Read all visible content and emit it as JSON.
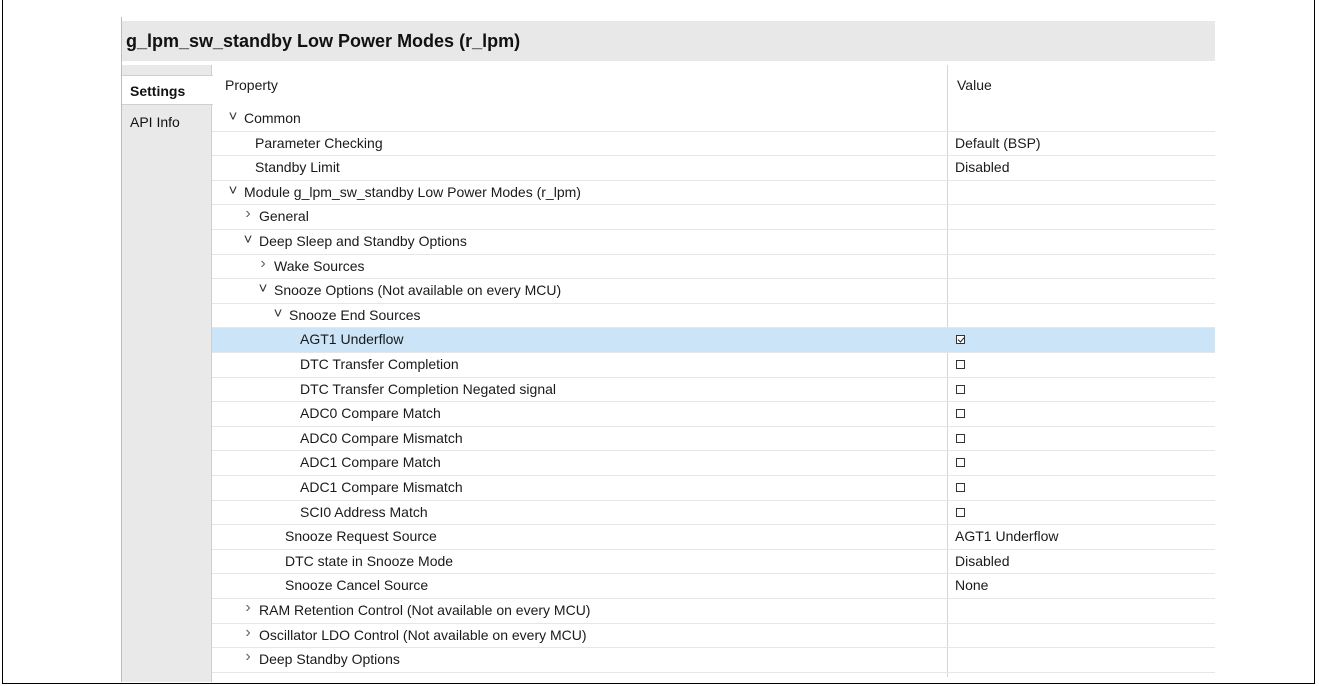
{
  "panel": {
    "title": "g_lpm_sw_standby Low Power Modes (r_lpm)",
    "tabs": [
      {
        "label": "Settings",
        "active": true
      },
      {
        "label": "API Info",
        "active": false
      }
    ]
  },
  "table": {
    "columns": {
      "property": "Property",
      "value": "Value"
    },
    "rows": [
      {
        "label": "Common",
        "level": 0,
        "toggle": "expanded",
        "value": ""
      },
      {
        "label": "Parameter Checking",
        "level": 1,
        "toggle": "none",
        "value": "Default (BSP)"
      },
      {
        "label": "Standby Limit",
        "level": 1,
        "toggle": "none",
        "value": "Disabled"
      },
      {
        "label": "Module g_lpm_sw_standby Low Power Modes (r_lpm)",
        "level": 0,
        "toggle": "expanded",
        "value": ""
      },
      {
        "label": "General",
        "level": 1,
        "toggle": "collapsed",
        "value": ""
      },
      {
        "label": "Deep Sleep and Standby Options",
        "level": 1,
        "toggle": "expanded",
        "value": ""
      },
      {
        "label": "Wake Sources",
        "level": 2,
        "toggle": "collapsed",
        "value": ""
      },
      {
        "label": "Snooze Options (Not available on every MCU)",
        "level": 2,
        "toggle": "expanded",
        "value": ""
      },
      {
        "label": "Snooze End Sources",
        "level": 3,
        "toggle": "expanded",
        "value": ""
      },
      {
        "label": "AGT1 Underflow",
        "level": 4,
        "toggle": "none",
        "checkbox": true,
        "checked": true,
        "selected": true
      },
      {
        "label": "DTC Transfer Completion",
        "level": 4,
        "toggle": "none",
        "checkbox": true,
        "checked": false
      },
      {
        "label": "DTC Transfer Completion Negated signal",
        "level": 4,
        "toggle": "none",
        "checkbox": true,
        "checked": false
      },
      {
        "label": "ADC0 Compare Match",
        "level": 4,
        "toggle": "none",
        "checkbox": true,
        "checked": false
      },
      {
        "label": "ADC0 Compare Mismatch",
        "level": 4,
        "toggle": "none",
        "checkbox": true,
        "checked": false
      },
      {
        "label": "ADC1 Compare Match",
        "level": 4,
        "toggle": "none",
        "checkbox": true,
        "checked": false
      },
      {
        "label": "ADC1 Compare Mismatch",
        "level": 4,
        "toggle": "none",
        "checkbox": true,
        "checked": false
      },
      {
        "label": "SCI0 Address Match",
        "level": 4,
        "toggle": "none",
        "checkbox": true,
        "checked": false
      },
      {
        "label": "Snooze Request Source",
        "level": 3,
        "toggle": "none",
        "value": "AGT1 Underflow"
      },
      {
        "label": "DTC state in Snooze Mode",
        "level": 3,
        "toggle": "none",
        "value": "Disabled"
      },
      {
        "label": "Snooze Cancel Source",
        "level": 3,
        "toggle": "none",
        "value": "None"
      },
      {
        "label": "RAM Retention Control (Not available on every MCU)",
        "level": 1,
        "toggle": "collapsed",
        "value": ""
      },
      {
        "label": "Oscillator LDO Control (Not available on every MCU)",
        "level": 1,
        "toggle": "collapsed",
        "value": ""
      },
      {
        "label": "Deep Standby Options",
        "level": 1,
        "toggle": "collapsed",
        "value": ""
      }
    ]
  },
  "colors": {
    "title_bar_bg": "#e8e8e8",
    "tab_strip_bg": "#e9e9e9",
    "selected_row_bg": "#cce4f7"
  }
}
